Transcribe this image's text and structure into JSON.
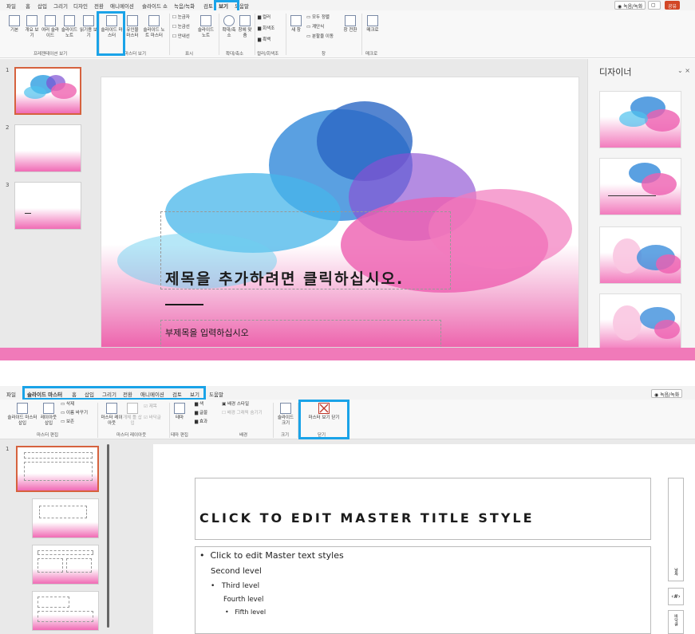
{
  "top": {
    "menu": [
      "파일",
      "홈",
      "삽입",
      "그리기",
      "디자인",
      "전환",
      "애니메이션",
      "슬라이드 쇼",
      "녹음/녹화",
      "검토",
      "보기",
      "도움말"
    ],
    "active_tab": "보기",
    "record_label": "◉ 녹음/녹화",
    "comment_label": "▢",
    "share_label": "공유",
    "ribbon_buttons": {
      "normal": "기본",
      "outline": "개요 보기",
      "sorter": "여러 슬라이드",
      "notes": "슬라이드 노트",
      "reading": "읽기용 보기",
      "slide_master": "슬라이드 마스터",
      "handout_master": "유인물 마스터",
      "notes_master": "슬라이드 노트 마스터",
      "ruler": "눈금자",
      "gridlines": "눈금선",
      "guides": "안내선",
      "notes_show": "슬라이드 노트",
      "zoom": "확대/축소",
      "fit": "창에 맞춤",
      "color": "컬러",
      "grayscale": "회색조",
      "bw": "흑백",
      "new_window": "새 창",
      "arrange_all": "모두 정렬",
      "cascade": "계단식",
      "move_split": "분할을 이동",
      "switch_window": "창 전환",
      "macros": "매크로"
    },
    "groups": {
      "presentation_views": "프레젠테이션 보기",
      "master_views": "마스터 보기",
      "show": "표시",
      "zoom": "확대/축소",
      "color": "컬러/회색조",
      "window": "창",
      "macros": "매크로"
    },
    "slide_numbers": [
      "1",
      "2",
      "3"
    ],
    "slide_title_placeholder": "제목을 추가하려면 클릭하십시오.",
    "slide_subtitle_placeholder": "부제목을 입력하십시오",
    "designer_title": "디자이너",
    "designer_controls": "⌄  ×"
  },
  "bottom": {
    "menu": [
      "파일",
      "슬라이드 마스터",
      "홈",
      "삽입",
      "그리기",
      "전환",
      "애니메이션",
      "검토",
      "보기",
      "도움말"
    ],
    "active_tab": "슬라이드 마스터",
    "record_label": "◉ 녹음/녹화",
    "ribbon_buttons": {
      "insert_master": "슬라이드 마스터 삽입",
      "insert_layout": "레이아웃 삽입",
      "delete": "삭제",
      "rename": "이름 바꾸기",
      "preserve": "보존",
      "master_layout": "마스터 레이아웃",
      "insert_placeholder": "개체 틀 삽입",
      "title_check": "제목",
      "footer_check": "바닥글",
      "themes": "테마",
      "colors": "색",
      "fonts": "글꼴",
      "effects": "효과",
      "bg_styles": "배경 스타일",
      "hide_bg": "배경 그래픽 숨기기",
      "slide_size": "슬라이드 크기",
      "close_master": "마스터 보기 닫기"
    },
    "groups": {
      "edit_master": "마스터 편집",
      "master_layout": "마스터 레이아웃",
      "edit_theme": "테마 편집",
      "background": "배경",
      "size": "크기",
      "close": "닫기"
    },
    "slide_number": "1",
    "master_title": "CLICK TO EDIT MASTER TITLE STYLE",
    "text_levels": [
      "Click to edit Master text styles",
      "Second level",
      "Third level",
      "Fourth level",
      "Fifth level"
    ],
    "vertical_date": "날짜",
    "page_num": "‹#›",
    "footer_vertical": "바닥글"
  },
  "colors": {
    "highlight": "#1aa3e8",
    "share": "#d24726",
    "pink": "#ed64ad"
  }
}
